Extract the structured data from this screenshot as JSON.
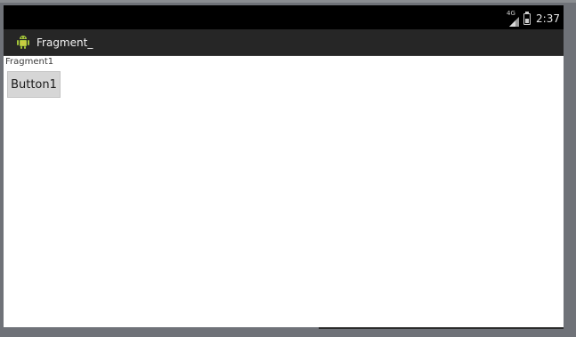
{
  "status_bar": {
    "network_label": "4G",
    "time": "2:37",
    "icons": [
      "signal-icon",
      "battery-icon"
    ]
  },
  "action_bar": {
    "title": "Fragment_",
    "icon": "android-app-icon"
  },
  "content": {
    "fragment_label": "Fragment1",
    "button_label": "Button1"
  },
  "colors": {
    "status_bar": "#000000",
    "action_bar": "#262626",
    "content_bg": "#ffffff",
    "button_bg": "#d6d6d6",
    "android_green": "#a4c639"
  }
}
